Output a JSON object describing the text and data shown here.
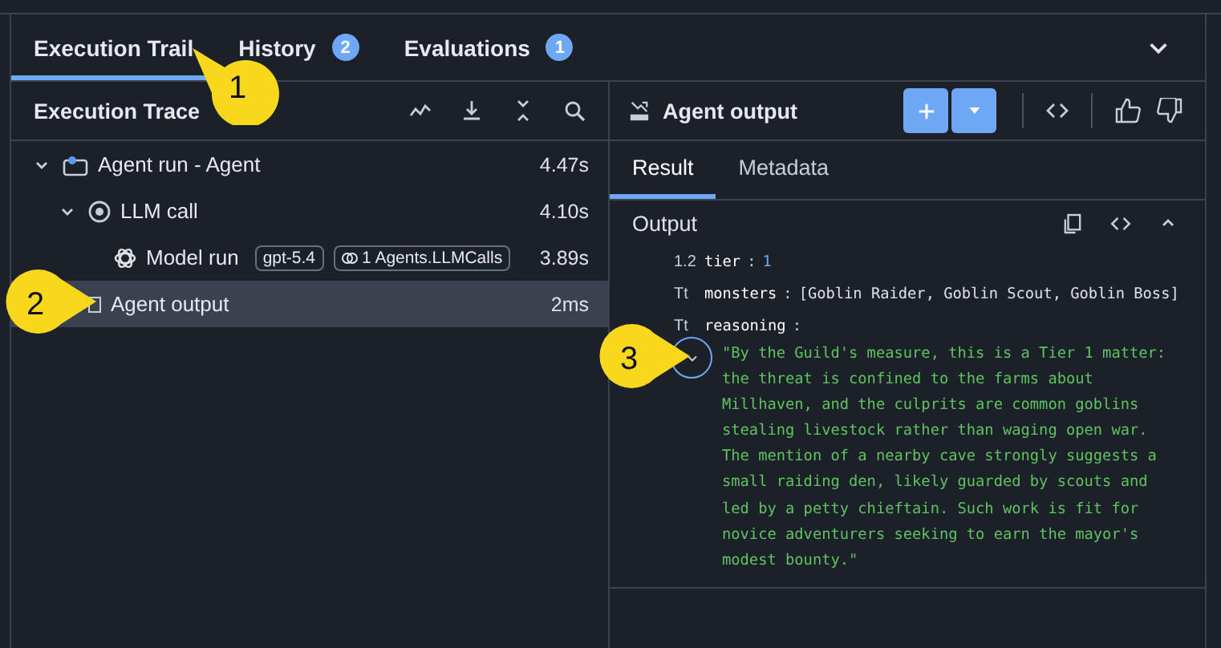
{
  "tabs": [
    {
      "label": "Execution Trail",
      "selected": true
    },
    {
      "label": "History",
      "badge": "2",
      "selected": false
    },
    {
      "label": "Evaluations",
      "badge": "1",
      "selected": false
    }
  ],
  "trace": {
    "title": "Execution Trace",
    "nodes": [
      {
        "label": "Agent run - Agent",
        "time": "4.47s",
        "kind": "agent",
        "expanded": true,
        "selected": false,
        "children": [
          {
            "label": "LLM call",
            "time": "4.10s",
            "kind": "llm",
            "expanded": true,
            "selected": false,
            "children": [
              {
                "label": "Model run",
                "time": "3.89s",
                "kind": "model",
                "selected": false,
                "tags": [
                  "gpt-5.4",
                  "1 Agents.LLMCalls"
                ]
              }
            ]
          },
          {
            "label": "Agent output",
            "time": "2ms",
            "kind": "output",
            "selected": true
          }
        ]
      }
    ]
  },
  "detail": {
    "title": "Agent output",
    "tabs": [
      {
        "label": "Result",
        "selected": true
      },
      {
        "label": "Metadata",
        "selected": false
      }
    ],
    "section": "Output",
    "fields": [
      {
        "type": "1.2",
        "key": "tier",
        "separator": ":",
        "value": "1",
        "kind": "number"
      },
      {
        "type": "Tt",
        "key": "monsters",
        "separator": ":",
        "value": "[Goblin Raider, Goblin Scout, Goblin Boss]",
        "kind": "list"
      },
      {
        "type": "Tt",
        "key": "reasoning",
        "separator": ":",
        "kind": "text",
        "expanded": true,
        "value": "\"By the Guild's measure, this is a Tier 1 matter: the threat is confined to the farms about Millhaven, and the culprits are common goblins stealing livestock rather than waging open war. The mention of a nearby cave strongly suggests a small raiding den, likely guarded by scouts and led by a petty chieftain. Such work is fit for novice adventurers seeking to earn the mayor's modest bounty.\""
      }
    ]
  },
  "callouts": [
    {
      "number": "1",
      "kind": "up-left"
    },
    {
      "number": "2",
      "kind": "right"
    },
    {
      "number": "3",
      "kind": "right"
    }
  ]
}
